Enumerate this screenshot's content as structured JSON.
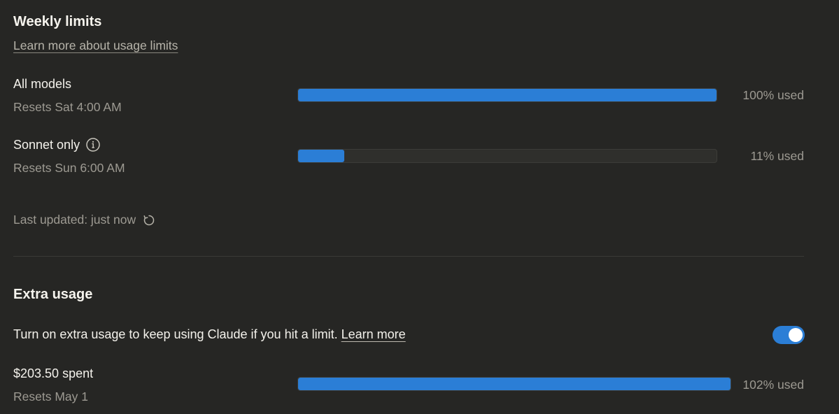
{
  "weekly": {
    "title": "Weekly limits",
    "learn_more": "Learn more about usage limits",
    "rows": [
      {
        "label": "All models",
        "resets": "Resets Sat 4:00 AM",
        "percent": 100,
        "used_text": "100% used"
      },
      {
        "label": "Sonnet only",
        "resets": "Resets Sun 6:00 AM",
        "percent": 11,
        "used_text": "11% used",
        "icon": "info-icon"
      }
    ],
    "last_updated": "Last updated: just now",
    "refresh_icon": "refresh-icon"
  },
  "extra": {
    "title": "Extra usage",
    "description": "Turn on extra usage to keep using Claude if you hit a limit.",
    "learn_more": "Learn more",
    "toggle_on": true,
    "spent": "$203.50 spent",
    "resets": "Resets May 1",
    "percent": 102,
    "used_text": "102% used"
  },
  "colors": {
    "background": "#262624",
    "accent": "#2b7ed6",
    "text": "#f4f2ec",
    "muted": "#9d9a92"
  }
}
